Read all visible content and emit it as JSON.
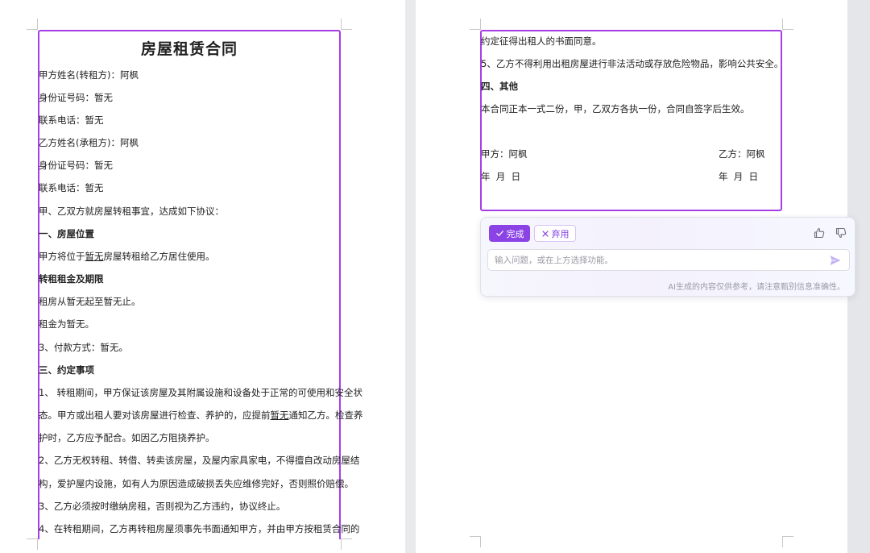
{
  "document": {
    "title": "房屋租赁合同",
    "left_lines": [
      "甲方姓名(转租方)：阿枫",
      "身份证号码：暂无",
      "联系电话：暂无",
      "乙方姓名(承租方)：阿枫",
      "身份证号码：暂无",
      "联系电话：暂无",
      "甲、乙双方就房屋转租事宜，达成如下协议：",
      "一、房屋位置",
      "甲方将位于",
      "暂无",
      "房屋转租给乙方居住使用。",
      "转租租金及期限",
      "租房从暂无起至暂无止。",
      "租金为暂无。",
      "3、付款方式：暂无。",
      "三、约定事项",
      "1、 转租期间，甲方保证该房屋及其附属设施和设备处于正常的可使用和安全状",
      "态。甲方或出租人要对该房屋进行检查、养护的，应提前",
      "暂无",
      "通知乙方。检查养",
      "护时，乙方应予配合。如因乙方阻挠养护。",
      "2、乙方无权转租、转借、转卖该房屋，及屋内家具家电，不得擅自改动房屋结",
      "构，爱护屋内设施，如有人为原因造成破损丢失应维修完好，否则照价赔偿。",
      "3、乙方必须按时缴纳房租，否则视为乙方违约，协议终止。",
      "4、在转租期间，乙方再转租房屋须事先书面通知甲方，并由甲方按租赁合同的"
    ],
    "right_lines": [
      "约定征得出租人的书面同意。",
      "5、乙方不得利用出租房屋进行非法活动或存放危险物品，影响公共安全。",
      "四、其他",
      "本合同正本一式二份，甲，乙双方各执一份，合同自签字后生效。",
      "甲方：阿枫",
      "乙方：阿枫",
      "年  月  日",
      "年  月  日"
    ]
  },
  "ai_panel": {
    "done_label": "完成",
    "discard_label": "弃用",
    "input_placeholder": "输入问题，或在上方选择功能。",
    "disclaimer": "AI生成的内容仅供参考，请注意甄别信息准确性。",
    "accent_color": "#8b43e6"
  },
  "icons": [
    "check-icon",
    "close-icon",
    "thumbs-up-icon",
    "thumbs-down-icon",
    "send-icon"
  ]
}
